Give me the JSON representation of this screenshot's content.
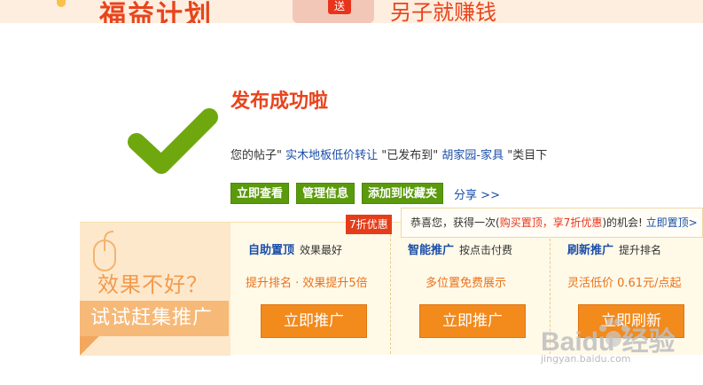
{
  "banner": {
    "left_text": "福益计划",
    "gift_tag": "送",
    "right_text": "另子就赚钱"
  },
  "success": {
    "title": "发布成功啦",
    "msg_prefix": "您的帖子\"",
    "post_title": "实木地板低价转让",
    "msg_mid": "\"已发布到\"",
    "category": "胡家园-家具",
    "msg_suffix": "\"类目下"
  },
  "actions": {
    "view": "立即查看",
    "manage": "管理信息",
    "favorite": "添加到收藏夹",
    "share": "分享 >>"
  },
  "promo": {
    "bad": "效果不好？",
    "try": "试试赶集推广",
    "discount_badge": "7折优惠",
    "tip_prefix": "恭喜您，获得一次(",
    "tip_highlight": "购买置顶，享7折优惠",
    ")的机会!": "",
    "tip_suffix": ")的机会!",
    "tip_link": "立即置顶>",
    "columns": [
      {
        "name": "自助置顶",
        "sub": "效果最好",
        "desc": "提升排名 · 效果提升5倍",
        "button": "立即推广"
      },
      {
        "name": "智能推广",
        "sub": "按点击付费",
        "desc": "多位置免费展示",
        "button": "立即推广"
      },
      {
        "name": "刷新推广",
        "sub": "提升排名",
        "desc": "灵活低价 0.61元/点起",
        "button": "立即刷新"
      }
    ]
  },
  "watermark": {
    "text": "Baidu 经验",
    "url": "jingyan.baidu.com"
  },
  "colors": {
    "accent": "#e8441c",
    "green": "#5a9a0c",
    "link": "#1a4ea8",
    "orange": "#f28a1c"
  }
}
